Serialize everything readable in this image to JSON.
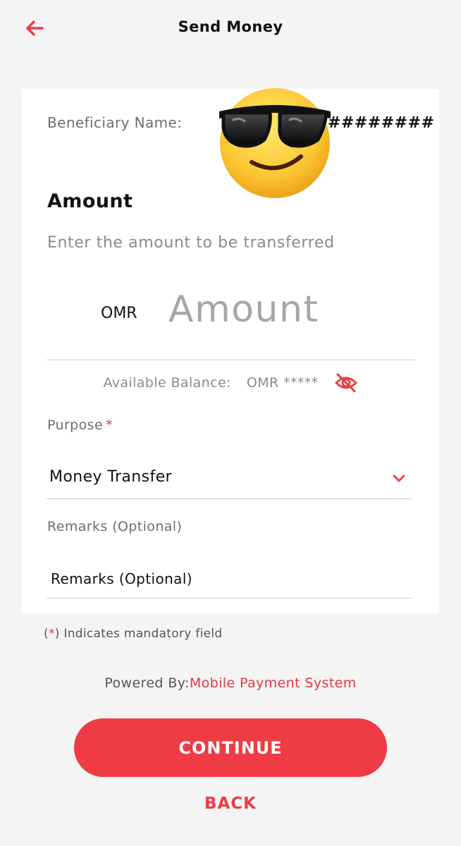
{
  "header": {
    "title": "Send Money",
    "back_icon": "arrow-left-icon"
  },
  "colors": {
    "accent": "#ef3b43",
    "background": "#f4f4f4",
    "card": "#ffffff"
  },
  "beneficiary": {
    "label": "Beneficiary Name:",
    "value": "########"
  },
  "amount": {
    "heading": "Amount",
    "hint": "Enter the amount to be transferred",
    "currency": "OMR",
    "placeholder": "Amount"
  },
  "balance": {
    "label": "Available Balance:",
    "value": "OMR *****",
    "toggle_icon": "eye-off-icon"
  },
  "purpose": {
    "label": "Purpose",
    "required_mark": "*",
    "selected": "Money Transfer",
    "dropdown_icon": "chevron-down-icon"
  },
  "remarks": {
    "label": "Remarks (Optional)",
    "placeholder": "Remarks (Optional)"
  },
  "footer": {
    "note_open": "(",
    "note_star": "*",
    "note_rest": ") Indicates mandatory field",
    "powered_prefix": "Powered By:",
    "powered_brand": "Mobile Payment System"
  },
  "actions": {
    "continue_label": "CONTINUE",
    "back_label": "BACK"
  }
}
